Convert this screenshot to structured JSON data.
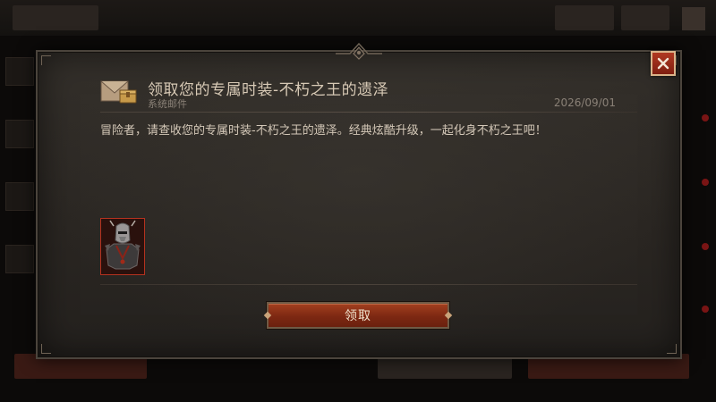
{
  "mail": {
    "title": "领取您的专属时装-不朽之王的遗泽",
    "sender": "系统邮件",
    "date": "2026/09/01",
    "body": "冒险者，请查收您的专属时装-不朽之王的遗泽。经典炫酷升级，一起化身不朽之王吧！",
    "attachment_icon": "armor-set-icon"
  },
  "buttons": {
    "claim_label": "领取",
    "close_icon": "close-icon"
  },
  "colors": {
    "accent_red": "#8a2a14",
    "title_text": "#d7c9b5",
    "item_border": "#b5321f"
  }
}
